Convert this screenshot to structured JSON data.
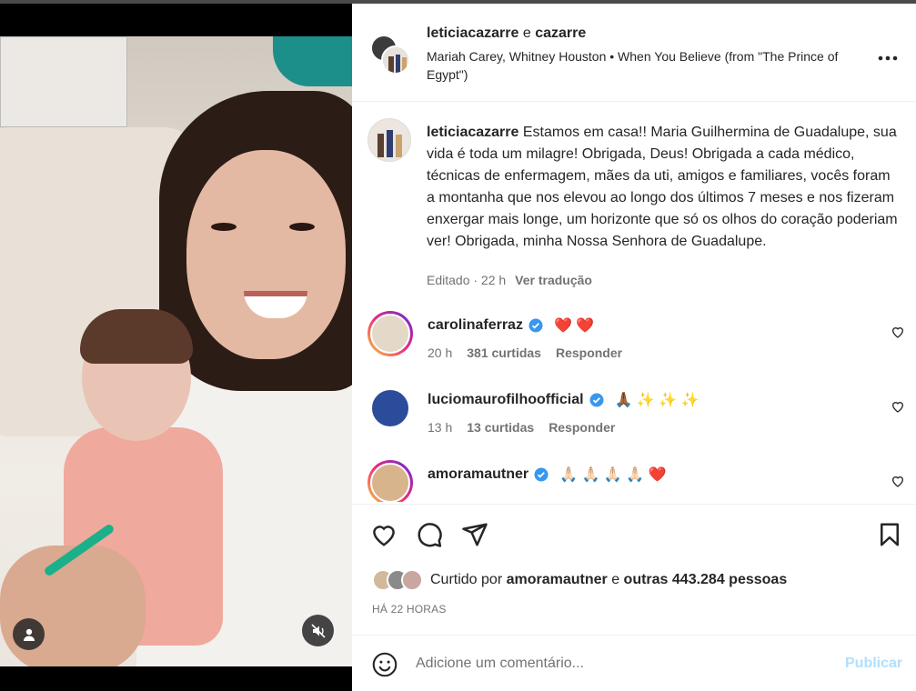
{
  "post": {
    "header": {
      "user1": "leticiacazarre",
      "join": " e ",
      "user2": "cazarre",
      "song": "Mariah Carey, Whitney Houston • When You Believe (from \"The Prince of Egypt\")",
      "more_icon": "more-horizontal-icon"
    },
    "caption": {
      "user": "leticiacazarre",
      "text": "Estamos em casa!! Maria Guilhermina de Guadalupe, sua vida é toda um milagre! Obrigada, Deus! Obrigada a cada médico, técnicas de enfermagem, mães da uti, amigos e familiares, vocês foram a montanha que nos elevou ao longo dos últimos 7 meses e nos fizeram enxergar mais longe, um horizonte que só os olhos do coração poderiam ver! Obrigada, minha Nossa Senhora de Guadalupe.",
      "edited": "Editado · 22 h",
      "translate": "Ver tradução"
    },
    "comments": [
      {
        "user": "carolinaferraz",
        "text": "❤️ ❤️",
        "time": "20 h",
        "likes": "381 curtidas",
        "reply": "Responder"
      },
      {
        "user": "luciomaurofilhoofficial",
        "text": "🙏🏾 ✨ ✨ ✨",
        "time": "13 h",
        "likes": "13 curtidas",
        "reply": "Responder"
      },
      {
        "user": "amoramautner",
        "text": "🙏🏻 🙏🏻 🙏🏻 🙏🏻 ❤️",
        "time": "",
        "likes": "",
        "reply": ""
      }
    ],
    "likes": {
      "prefix": "Curtido por ",
      "user": "amoramautner",
      "middle": " e ",
      "others": "outras 443.284 pessoas"
    },
    "time_ago": "HÁ 22 HORAS",
    "add_comment": {
      "placeholder": "Adicione um comentário...",
      "publish": "Publicar"
    }
  },
  "colors": {
    "verified": "#3897f0",
    "publish_disabled": "#b2dffc",
    "muted": "#737373"
  }
}
